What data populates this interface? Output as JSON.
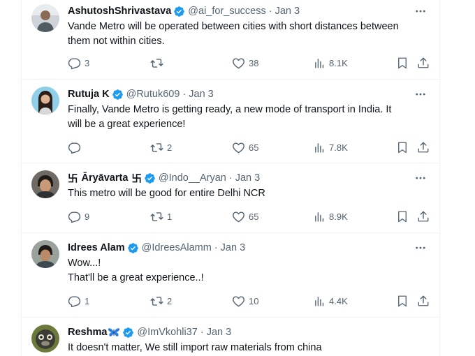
{
  "colors": {
    "verified": "#1d9bf0",
    "secondary_text": "#536471",
    "divider": "#eff3f4"
  },
  "icons": {
    "reply": "reply-bubble-icon",
    "retweet": "retweet-arrows-icon",
    "like": "heart-icon",
    "views": "bar-chart-icon",
    "bookmark": "bookmark-icon",
    "share": "share-upload-icon",
    "more": "more-dots-icon",
    "verified": "verified-badge-icon",
    "butterfly": "butterfly-emoji"
  },
  "tweets": [
    {
      "name": "AshutoshShrivastava",
      "handle": "@ai_for_success",
      "separator": "·",
      "date": "Jan 3",
      "lines": [
        "Vande Metro will be operated between cities with short distances between",
        "them not within cities."
      ],
      "replies": "3",
      "retweets": "",
      "likes": "38",
      "views": "8.1K"
    },
    {
      "name": "Rutuja K",
      "handle": "@Rutuk609",
      "separator": "·",
      "date": "Jan 3",
      "lines": [
        "Finally, Vande Metro is getting ready, a new mode of transport in India. It",
        "will be a great experience!"
      ],
      "replies": "",
      "retweets": "2",
      "likes": "65",
      "views": "7.8K"
    },
    {
      "name_prefix": "卐",
      "name": "Āryāvarta",
      "name_suffix": "卐",
      "handle": "@Indo__Aryan",
      "separator": "·",
      "date": "Jan 3",
      "lines": [
        "This metro will be good for entire Delhi NCR"
      ],
      "replies": "9",
      "retweets": "1",
      "likes": "65",
      "views": "8.9K"
    },
    {
      "name": "Idrees Alam",
      "handle": "@IdreesAlamm",
      "separator": "·",
      "date": "Jan 3",
      "lines": [
        "Wow...!",
        "That'll be a great experience..!"
      ],
      "replies": "1",
      "retweets": "2",
      "likes": "10",
      "views": "4.4K"
    },
    {
      "name": "Reshma",
      "handle": "@ImVkohli37",
      "separator": "·",
      "date": "Jan 3",
      "lines": [
        "It doesn't matter, We still import raw materials from china"
      ]
    }
  ]
}
